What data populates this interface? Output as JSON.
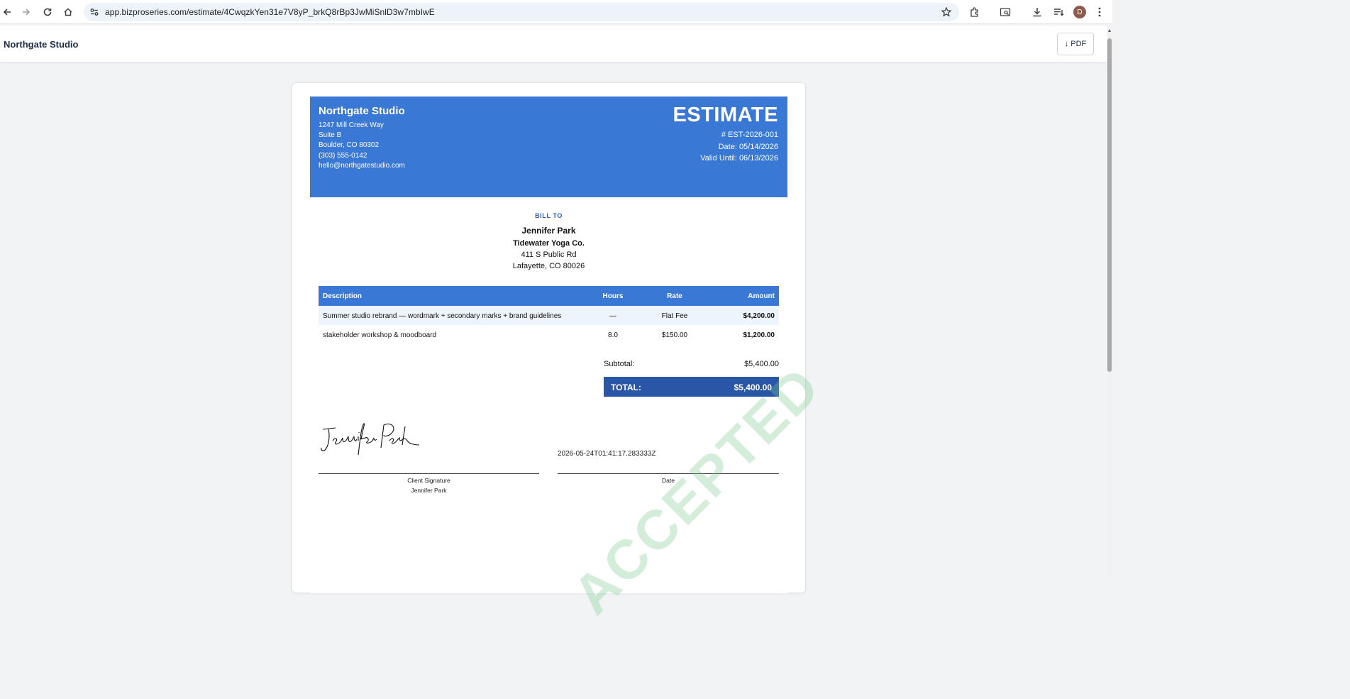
{
  "browser": {
    "url": "app.bizproseries.com/estimate/4CwqzkYen31e7V8yP_brkQ8rBp3JwMiSnlD3w7mbIwE",
    "profile_initial": "D"
  },
  "app": {
    "brand": "Northgate Studio",
    "pdf_button": "↓ PDF"
  },
  "estimate": {
    "company": {
      "name": "Northgate Studio",
      "address_lines": [
        "1247 Mill Creek Way",
        "Suite B",
        "Boulder, CO 80302",
        "(303) 555-0142",
        "hello@northgatestudio.com"
      ]
    },
    "title": "ESTIMATE",
    "number": "# EST-2026-001",
    "date": "Date: 05/14/2026",
    "valid_until": "Valid Until: 06/13/2026",
    "bill_to": {
      "label": "BILL TO",
      "name": "Jennifer Park",
      "company": "Tidewater Yoga Co.",
      "address_lines": [
        "411 S Public Rd",
        "Lafayette, CO 80026"
      ]
    },
    "table": {
      "headers": {
        "description": "Description",
        "hours": "Hours",
        "rate": "Rate",
        "amount": "Amount"
      },
      "rows": [
        {
          "description": "Summer studio rebrand — wordmark + secondary marks + brand guidelines",
          "hours": "—",
          "rate": "Flat Fee",
          "amount": "$4,200.00"
        },
        {
          "description": "stakeholder workshop & moodboard",
          "hours": "8.0",
          "rate": "$150.00",
          "amount": "$1,200.00"
        }
      ]
    },
    "subtotal_label": "Subtotal:",
    "subtotal_value": "$5,400.00",
    "total_label": "TOTAL:",
    "total_value": "$5,400.00",
    "signature": {
      "signed_name": "Jennifer Park",
      "signature_caption": "Client Signature",
      "signer_name": "Jennifer Park",
      "date_value": "2026-05-24T01:41:17.283333Z",
      "date_caption": "Date"
    },
    "watermark": "ACCEPTED"
  }
}
